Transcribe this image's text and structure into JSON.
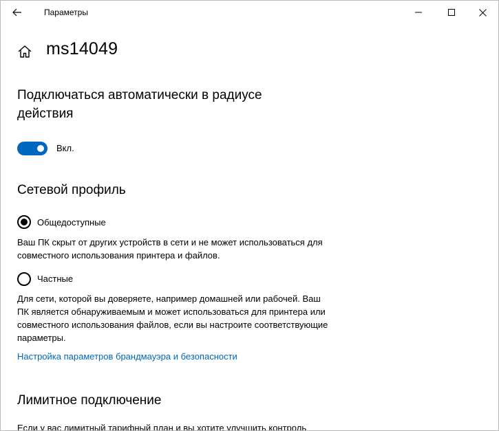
{
  "window": {
    "title": "Параметры"
  },
  "page": {
    "title": "ms14049"
  },
  "auto_connect": {
    "heading": "Подключаться автоматически в радиусе действия",
    "toggle_state": "on",
    "toggle_label": "Вкл."
  },
  "network_profile": {
    "heading": "Сетевой профиль",
    "selected": "public",
    "options": [
      {
        "label": "Общедоступные",
        "description": "Ваш ПК скрыт от других устройств в сети и не может использоваться для совместного использования принтера и файлов."
      },
      {
        "label": "Частные",
        "description": "Для сети, которой вы доверяете, например домашней или рабочей. Ваш ПК является обнаруживаемым и может использоваться для принтера или совместного использования файлов, если вы настроите соответствующие параметры."
      }
    ],
    "firewall_link": "Настройка параметров брандмауэра и безопасности"
  },
  "metered": {
    "heading": "Лимитное подключение",
    "description": "Если у вас лимитный тарифный план и вы хотите улучшить контроль"
  },
  "colors": {
    "accent": "#0067c0",
    "link": "#0067b8"
  },
  "icons": {
    "back": "back-arrow-icon",
    "home": "home-icon",
    "minimize": "minimize-icon",
    "maximize": "maximize-icon",
    "close": "close-icon"
  }
}
